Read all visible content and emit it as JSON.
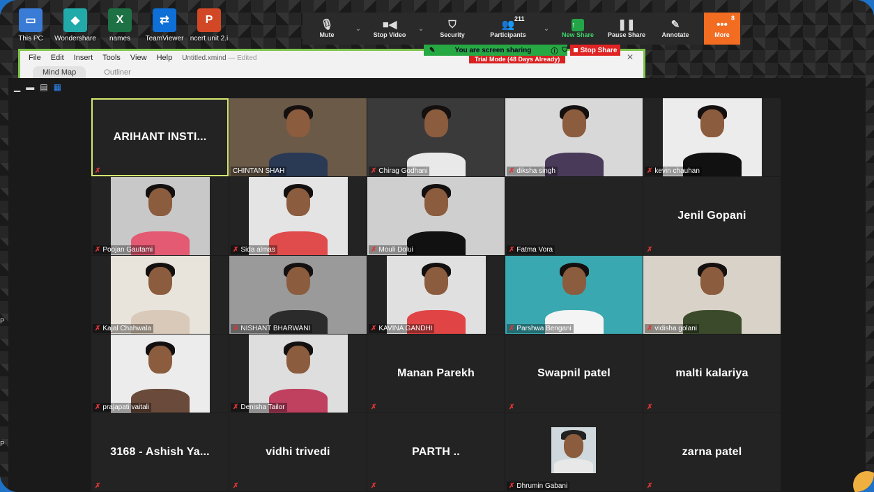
{
  "desktop": {
    "icons": [
      {
        "label": "This PC",
        "icon": "pc-icon",
        "color": "#3a7bd5",
        "glyph": "▭"
      },
      {
        "label": "Wondershare",
        "icon": "wondershare-icon",
        "color": "#2aa",
        "glyph": "◆"
      },
      {
        "label": "names",
        "icon": "excel-icon",
        "color": "#1d7145",
        "glyph": "X"
      },
      {
        "label": "TeamViewer",
        "icon": "teamviewer-icon",
        "color": "#0e6fd6",
        "glyph": "⇄"
      },
      {
        "label": "ncert unit 2.i",
        "icon": "powerpoint-icon",
        "color": "#d24726",
        "glyph": "P"
      }
    ]
  },
  "toolbar": {
    "mute": "Mute",
    "stop_video": "Stop Video",
    "security": "Security",
    "participants": "Participants",
    "participants_count": "211",
    "new_share": "New Share",
    "pause_share": "Pause Share",
    "annotate": "Annotate",
    "more": "More",
    "more_badge": "8"
  },
  "share_banner": {
    "text": "You are screen sharing",
    "stop": "Stop Share"
  },
  "xmind": {
    "menu": [
      "File",
      "Edit",
      "Insert",
      "Tools",
      "View",
      "Help"
    ],
    "doc_title": "Untitled.xmind",
    "doc_status": "— Edited",
    "trial": "Trial Mode (48 Days Already)",
    "tabs": [
      "Mind Map",
      "Outliner"
    ]
  },
  "participants": [
    {
      "name": "ARIHANT INSTI...",
      "video": false,
      "label": "",
      "active": true
    },
    {
      "name": "CHINTAN SHAH",
      "video": true,
      "label": "CHINTAN SHAH",
      "shirt": "#2a3a55",
      "bg": "#6b5a48",
      "muted": false
    },
    {
      "name": "Chirag Godhani",
      "video": true,
      "label": "Chirag Godhani",
      "shirt": "#e9e9e9",
      "bg": "#3a3a3a",
      "muted": true
    },
    {
      "name": "diksha singh",
      "video": true,
      "label": "diksha singh",
      "shirt": "#4a3a5a",
      "bg": "#d8d8d8",
      "muted": true
    },
    {
      "name": "kevin chauhan",
      "video": true,
      "label": "kevin chauhan",
      "shirt": "#111",
      "bg": "#ececec",
      "muted": true
    },
    {
      "name": "Poojan Gautami",
      "video": true,
      "label": "Poojan Gautami",
      "shirt": "#e35a72",
      "bg": "#c8c8c8",
      "muted": true
    },
    {
      "name": "Sida almas",
      "video": true,
      "label": "Sida almas",
      "shirt": "#e04b4b",
      "bg": "#e4e4e4",
      "muted": true
    },
    {
      "name": "Mouli Dolui",
      "video": true,
      "label": "Mouli Dolui",
      "shirt": "#111",
      "bg": "#cfcfcf",
      "muted": true
    },
    {
      "name": "Fatma Vora",
      "video": false,
      "label": "Fatma Vora",
      "blank": true,
      "muted": true
    },
    {
      "name": "Jenil Gopani",
      "video": false,
      "label": "",
      "muted": true
    },
    {
      "name": "Kajal Chahwala",
      "video": true,
      "label": "Kajal Chahwala",
      "shirt": "#d9c9b9",
      "bg": "#e8e4dc",
      "muted": true
    },
    {
      "name": "NISHANT BHARWANI",
      "video": true,
      "label": "NISHANT BHARWANI",
      "shirt": "#2b2b2b",
      "bg": "#9a9a9a",
      "muted": true
    },
    {
      "name": "KAVINA GANDHI",
      "video": true,
      "label": "KAVINA GANDHI",
      "shirt": "#e04444",
      "bg": "#e0e0e0",
      "muted": true
    },
    {
      "name": "Parshwa Bengani",
      "video": true,
      "label": "Parshwa Bengani",
      "shirt": "#f4f4f4",
      "bg": "#3aa8b0",
      "muted": true
    },
    {
      "name": "vidisha golani",
      "video": true,
      "label": "vidisha golani",
      "shirt": "#3a4a2a",
      "bg": "#d8d2c8",
      "muted": true
    },
    {
      "name": "prajapati vaitali",
      "video": true,
      "label": "prajapati vaitali",
      "shirt": "#6a4a3a",
      "bg": "#ececec",
      "muted": true
    },
    {
      "name": "Denisha Tailor",
      "video": true,
      "label": "Denisha Tailor",
      "shirt": "#c04060",
      "bg": "#dedede",
      "muted": true
    },
    {
      "name": "Manan Parekh",
      "video": false,
      "label": "",
      "muted": true
    },
    {
      "name": "Swapnil patel",
      "video": false,
      "label": "",
      "muted": true
    },
    {
      "name": "malti kalariya",
      "video": false,
      "label": "",
      "muted": true
    },
    {
      "name": "3168 - Ashish Ya...",
      "video": false,
      "label": "",
      "muted": true
    },
    {
      "name": "vidhi trivedi",
      "video": false,
      "label": "",
      "muted": true
    },
    {
      "name": "PARTH ..",
      "video": false,
      "label": "",
      "muted": true
    },
    {
      "name": "Dhrumin Gabani",
      "video": false,
      "photo": true,
      "label": "Dhrumin Gabani",
      "muted": true
    },
    {
      "name": "zarna patel",
      "video": false,
      "label": "",
      "muted": true
    }
  ]
}
